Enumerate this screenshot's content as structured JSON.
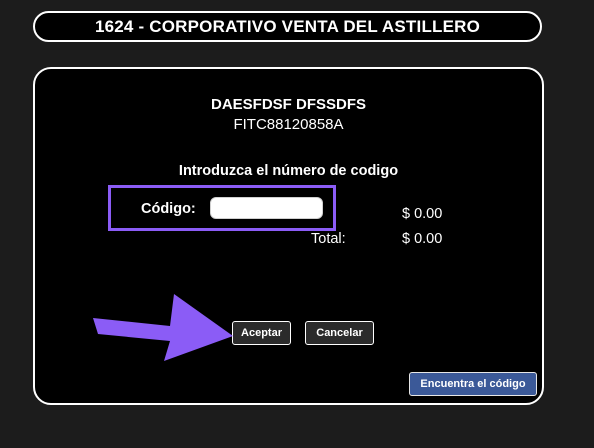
{
  "header": {
    "title": "1624 - CORPORATIVO VENTA DEL ASTILLERO"
  },
  "customer": {
    "name": "DAESFDSF DFSSDFS",
    "rfc": "FITC88120858A"
  },
  "prompt": "Introduzca el número de codigo",
  "code": {
    "label": "Código:",
    "value": ""
  },
  "amounts": {
    "first": "$ 0.00",
    "total_label": "Total:",
    "total": "$ 0.00"
  },
  "buttons": {
    "accept": "Aceptar",
    "cancel": "Cancelar",
    "find_code": "Encuentra el código"
  },
  "colors": {
    "highlight": "#8b5cf6",
    "find_button": "#3b5998",
    "background": "#1c1c1c"
  }
}
